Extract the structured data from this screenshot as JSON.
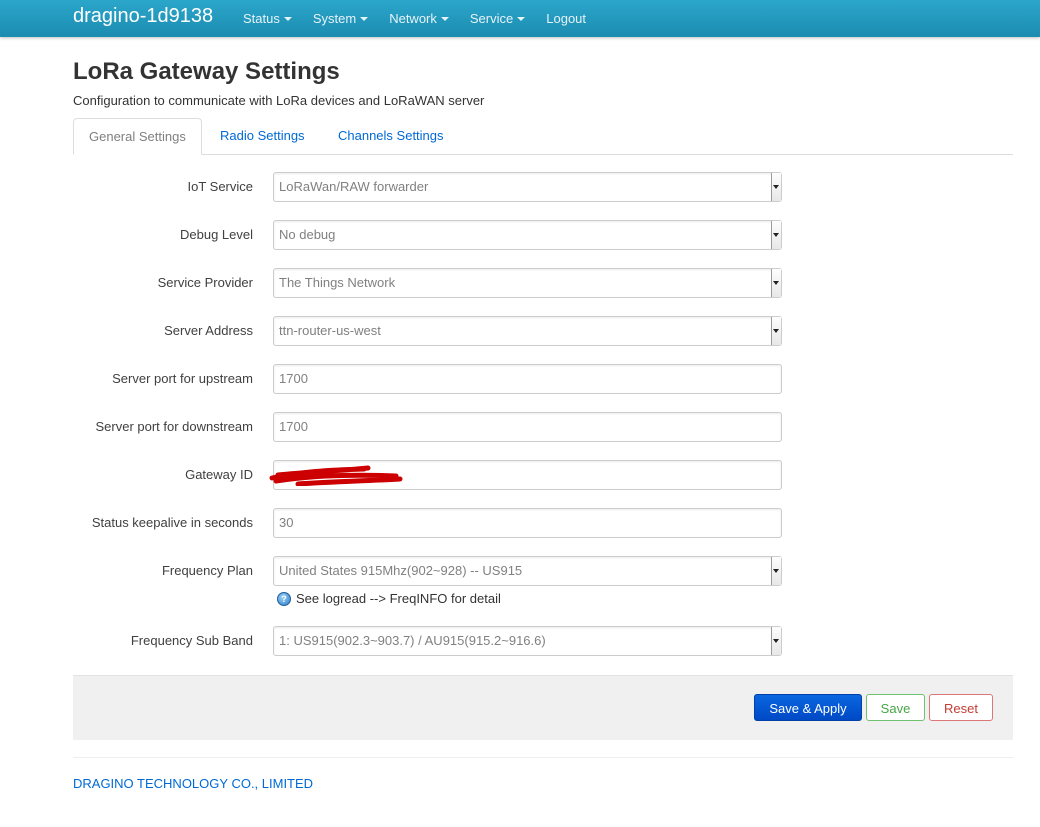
{
  "navbar": {
    "brand": "dragino-1d9138",
    "items": [
      {
        "label": "Status",
        "dropdown": true
      },
      {
        "label": "System",
        "dropdown": true
      },
      {
        "label": "Network",
        "dropdown": true
      },
      {
        "label": "Service",
        "dropdown": true
      },
      {
        "label": "Logout",
        "dropdown": false
      }
    ]
  },
  "page": {
    "title": "LoRa Gateway Settings",
    "description": "Configuration to communicate with LoRa devices and LoRaWAN server"
  },
  "tabs": [
    {
      "label": "General Settings",
      "active": true
    },
    {
      "label": "Radio Settings",
      "active": false
    },
    {
      "label": "Channels Settings",
      "active": false
    }
  ],
  "form": {
    "iot_service": {
      "label": "IoT Service",
      "value": "LoRaWan/RAW forwarder"
    },
    "debug_level": {
      "label": "Debug Level",
      "value": "No debug"
    },
    "service_provider": {
      "label": "Service Provider",
      "value": "The Things Network"
    },
    "server_address": {
      "label": "Server Address",
      "value": "ttn-router-us-west"
    },
    "port_up": {
      "label": "Server port for upstream",
      "value": "1700"
    },
    "port_down": {
      "label": "Server port for downstream",
      "value": "1700"
    },
    "gateway_id": {
      "label": "Gateway ID",
      "value": ""
    },
    "keepalive": {
      "label": "Status keepalive in seconds",
      "value": "30"
    },
    "freq_plan": {
      "label": "Frequency Plan",
      "value": "United States 915Mhz(902~928) -- US915",
      "hint": "See logread --> FreqINFO for detail"
    },
    "sub_band": {
      "label": "Frequency Sub Band",
      "value": "1: US915(902.3~903.7) / AU915(915.2~916.6)"
    }
  },
  "actions": {
    "save_apply": "Save & Apply",
    "save": "Save",
    "reset": "Reset"
  },
  "footer": {
    "company": "DRAGINO TECHNOLOGY CO., LIMITED"
  },
  "colors": {
    "navbar": "#2ba6cb",
    "link": "#0069d6",
    "apply": "#0a66e0",
    "save": "#46a546",
    "reset": "#c43c35",
    "redaction": "#cc0000"
  }
}
